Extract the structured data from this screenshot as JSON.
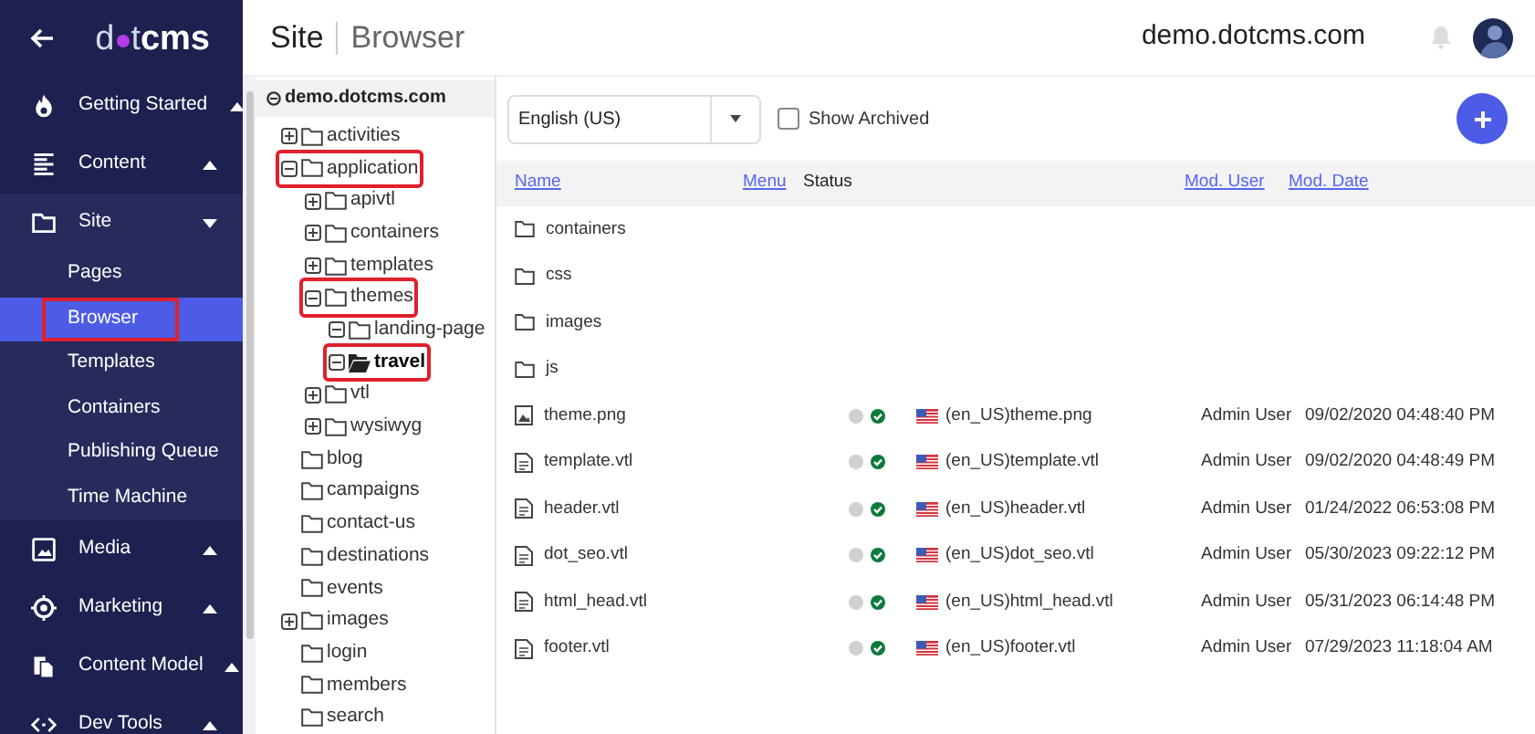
{
  "logo": {
    "before_dot": "d",
    "after_dot": "t",
    "bold": "cms"
  },
  "nav": [
    {
      "label": "Getting Started",
      "kind": "flame",
      "expanded": false
    },
    {
      "label": "Content",
      "kind": "lines",
      "expanded": false
    },
    {
      "label": "Site",
      "kind": "folder",
      "expanded": true,
      "children": [
        {
          "label": "Pages",
          "selected": false,
          "highlighted": false
        },
        {
          "label": "Browser",
          "selected": true,
          "highlighted": true
        },
        {
          "label": "Templates",
          "selected": false,
          "highlighted": false
        },
        {
          "label": "Containers",
          "selected": false,
          "highlighted": false
        },
        {
          "label": "Publishing Queue",
          "selected": false,
          "highlighted": false
        },
        {
          "label": "Time Machine",
          "selected": false,
          "highlighted": false
        }
      ]
    },
    {
      "label": "Media",
      "kind": "image",
      "expanded": false
    },
    {
      "label": "Marketing",
      "kind": "target",
      "expanded": false
    },
    {
      "label": "Content Model",
      "kind": "files",
      "expanded": false
    },
    {
      "label": "Dev Tools",
      "kind": "code",
      "expanded": false
    }
  ],
  "breadcrumb": {
    "section": "Site",
    "page": "Browser"
  },
  "site_name": "demo.dotcms.com",
  "tree": {
    "root": "demo.dotcms.com",
    "items": [
      {
        "label": "activities",
        "expandable": true,
        "expanded": false,
        "selected": false,
        "highlighted": false
      },
      {
        "label": "application",
        "expandable": true,
        "expanded": true,
        "selected": false,
        "highlighted": true,
        "children": [
          {
            "label": "apivtl",
            "expandable": true,
            "expanded": false,
            "selected": false,
            "highlighted": false
          },
          {
            "label": "containers",
            "expandable": true,
            "expanded": false,
            "selected": false,
            "highlighted": false
          },
          {
            "label": "templates",
            "expandable": true,
            "expanded": false,
            "selected": false,
            "highlighted": false
          },
          {
            "label": "themes",
            "expandable": true,
            "expanded": true,
            "selected": false,
            "highlighted": true,
            "children": [
              {
                "label": "landing-page",
                "expandable": true,
                "expanded": true,
                "selected": false,
                "highlighted": false
              },
              {
                "label": "travel",
                "expandable": true,
                "expanded": true,
                "selected": true,
                "highlighted": true
              }
            ]
          },
          {
            "label": "vtl",
            "expandable": true,
            "expanded": false,
            "selected": false,
            "highlighted": false
          },
          {
            "label": "wysiwyg",
            "expandable": true,
            "expanded": false,
            "selected": false,
            "highlighted": false
          }
        ]
      },
      {
        "label": "blog",
        "expandable": false,
        "expanded": false,
        "selected": false,
        "highlighted": false
      },
      {
        "label": "campaigns",
        "expandable": false,
        "expanded": false,
        "selected": false,
        "highlighted": false
      },
      {
        "label": "contact-us",
        "expandable": false,
        "expanded": false,
        "selected": false,
        "highlighted": false
      },
      {
        "label": "destinations",
        "expandable": false,
        "expanded": false,
        "selected": false,
        "highlighted": false
      },
      {
        "label": "events",
        "expandable": false,
        "expanded": false,
        "selected": false,
        "highlighted": false
      },
      {
        "label": "images",
        "expandable": true,
        "expanded": false,
        "selected": false,
        "highlighted": false
      },
      {
        "label": "login",
        "expandable": false,
        "expanded": false,
        "selected": false,
        "highlighted": false
      },
      {
        "label": "members",
        "expandable": false,
        "expanded": false,
        "selected": false,
        "highlighted": false
      },
      {
        "label": "search",
        "expandable": false,
        "expanded": false,
        "selected": false,
        "highlighted": false
      }
    ]
  },
  "toolbar": {
    "language": "English (US)",
    "show_archived": {
      "label": "Show Archived",
      "checked": false
    }
  },
  "table": {
    "columns": [
      "Name",
      "Menu",
      "Status",
      "Mod. User",
      "Mod. Date"
    ],
    "rows": [
      {
        "kind": "folder",
        "name": "containers"
      },
      {
        "kind": "folder",
        "name": "css"
      },
      {
        "kind": "folder",
        "name": "images"
      },
      {
        "kind": "folder",
        "name": "js"
      },
      {
        "kind": "image",
        "name": "theme.png",
        "live": true,
        "title": "(en_US)theme.png",
        "user": "Admin User",
        "date": "09/02/2020 04:48:40 PM"
      },
      {
        "kind": "file",
        "name": "template.vtl",
        "live": true,
        "title": "(en_US)template.vtl",
        "user": "Admin User",
        "date": "09/02/2020 04:48:49 PM"
      },
      {
        "kind": "file",
        "name": "header.vtl",
        "live": true,
        "title": "(en_US)header.vtl",
        "user": "Admin User",
        "date": "01/24/2022 06:53:08 PM"
      },
      {
        "kind": "file",
        "name": "dot_seo.vtl",
        "live": true,
        "title": "(en_US)dot_seo.vtl",
        "user": "Admin User",
        "date": "05/30/2023 09:22:12 PM"
      },
      {
        "kind": "file",
        "name": "html_head.vtl",
        "live": true,
        "title": "(en_US)html_head.vtl",
        "user": "Admin User",
        "date": "05/31/2023 06:14:48 PM"
      },
      {
        "kind": "file",
        "name": "footer.vtl",
        "live": true,
        "title": "(en_US)footer.vtl",
        "user": "Admin User",
        "date": "07/29/2023 11:18:04 AM"
      }
    ]
  }
}
